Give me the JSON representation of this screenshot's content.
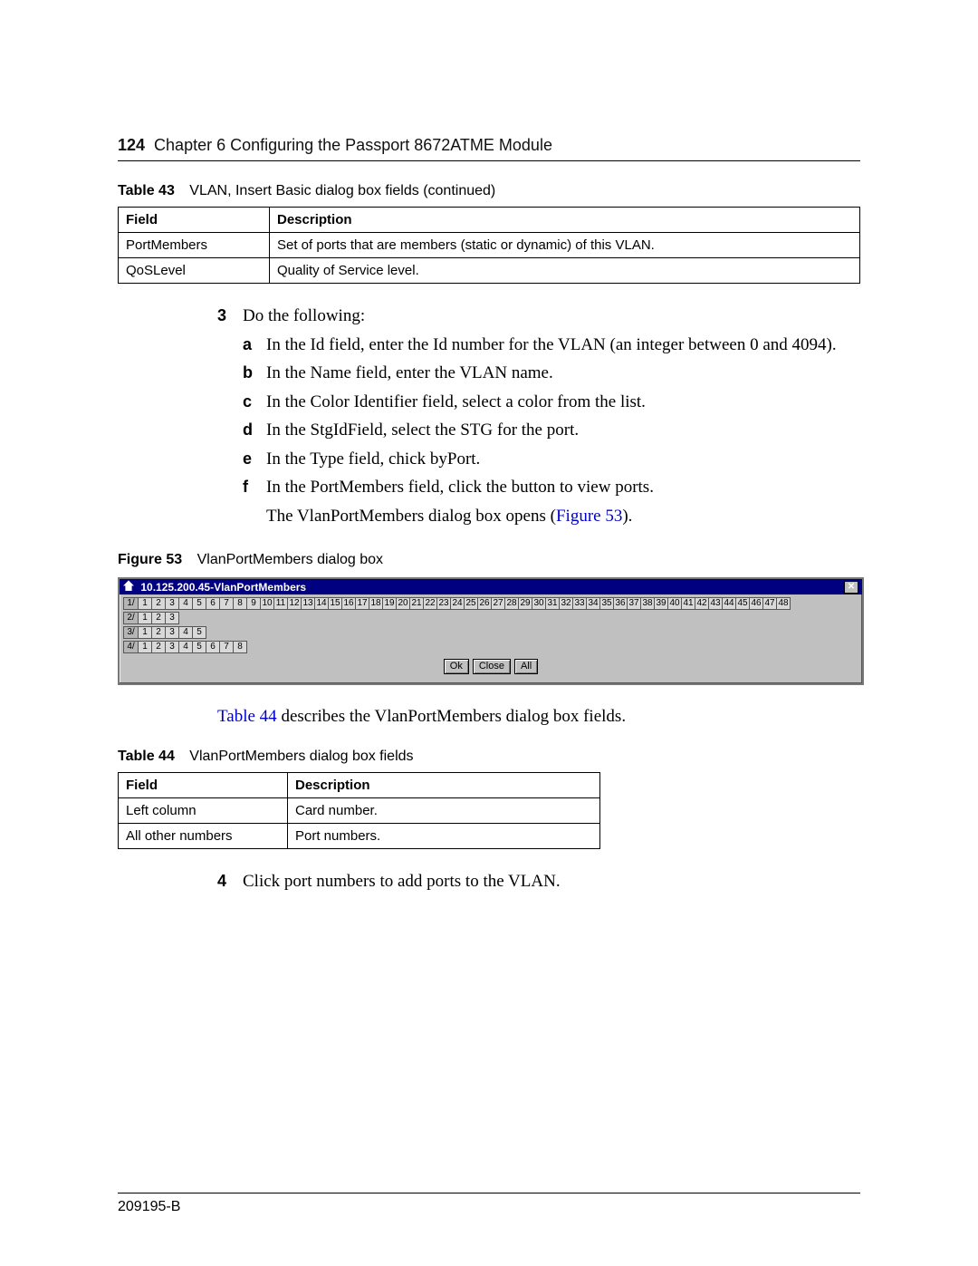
{
  "page_number": "124",
  "chapter_line": "Chapter 6  Configuring the Passport 8672ATME Module",
  "table43": {
    "label": "Table 43",
    "caption": "VLAN, Insert Basic dialog box fields (continued)",
    "headers": [
      "Field",
      "Description"
    ],
    "rows": [
      [
        "PortMembers",
        "Set of ports that are members (static or dynamic) of this VLAN."
      ],
      [
        "QoSLevel",
        "Quality of Service level."
      ]
    ]
  },
  "step3": {
    "num": "3",
    "lead": "Do the following:",
    "subs": [
      {
        "l": "a",
        "t": "In the Id field, enter the Id number for the VLAN (an integer between 0 and 4094)."
      },
      {
        "l": "b",
        "t": "In the Name field, enter the VLAN name."
      },
      {
        "l": "c",
        "t": "In the Color Identifier field, select a color from the list."
      },
      {
        "l": "d",
        "t": "In the StgIdField, select the STG for the port."
      },
      {
        "l": "e",
        "t": "In the Type field, chick byPort."
      },
      {
        "l": "f",
        "t": "In the PortMembers field, click the button to view ports."
      }
    ],
    "tail_pre": "The VlanPortMembers dialog box opens (",
    "tail_link": "Figure 53",
    "tail_post": ")."
  },
  "figure53": {
    "label": "Figure 53",
    "caption": "VlanPortMembers dialog box",
    "title": "10.125.200.45-VlanPortMembers",
    "rows": [
      {
        "slot": "1/",
        "count": 48
      },
      {
        "slot": "2/",
        "count": 3
      },
      {
        "slot": "3/",
        "count": 5
      },
      {
        "slot": "4/",
        "count": 8
      }
    ],
    "buttons": [
      "Ok",
      "Close",
      "All"
    ]
  },
  "mid_link": "Table 44",
  "mid_rest": " describes the VlanPortMembers dialog box fields.",
  "table44": {
    "label": "Table 44",
    "caption": "VlanPortMembers dialog box fields",
    "headers": [
      "Field",
      "Description"
    ],
    "rows": [
      [
        "Left column",
        "Card number."
      ],
      [
        "All other numbers",
        "Port numbers."
      ]
    ]
  },
  "step4": {
    "num": "4",
    "text": "Click port numbers to add ports to the VLAN."
  },
  "footer": "209195-B"
}
